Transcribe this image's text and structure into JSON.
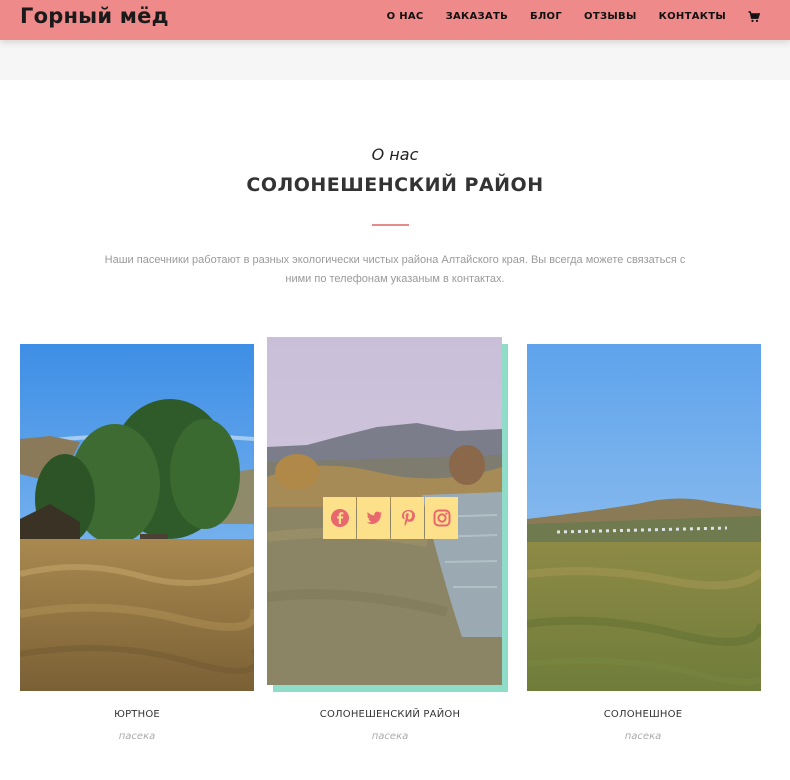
{
  "header": {
    "brand": "Горный мёд",
    "nav": [
      "О НАС",
      "ЗАКАЗАТЬ",
      "БЛОГ",
      "ОТЗЫВЫ",
      "КОНТАКТЫ"
    ],
    "cart_icon": "cart-icon"
  },
  "about": {
    "subtitle": "О нас",
    "title": "СОЛОНЕШЕНСКИЙ РАЙОН",
    "text": "Наши пасечники работают в разных экологически чистых района Алтайского края. Вы всегда можете связаться с ними по телефонам указаным в контактах."
  },
  "cards": [
    {
      "name": "ЮРТНОЕ",
      "role": "пасека"
    },
    {
      "name": "СОЛОНЕШЕНСКИЙ РАЙОН",
      "role": "пасека"
    },
    {
      "name": "СОЛОНЕШНОЕ",
      "role": "пасека"
    }
  ],
  "social_icons": [
    "facebook-icon",
    "twitter-icon",
    "pinterest-icon",
    "instagram-icon"
  ],
  "colors": {
    "header_bg": "#ee8a8a",
    "accent_divider": "#e68a8a",
    "card_highlight": "#8fdcc9",
    "social_bg": "#fde08a",
    "social_icon": "#e8686e"
  }
}
